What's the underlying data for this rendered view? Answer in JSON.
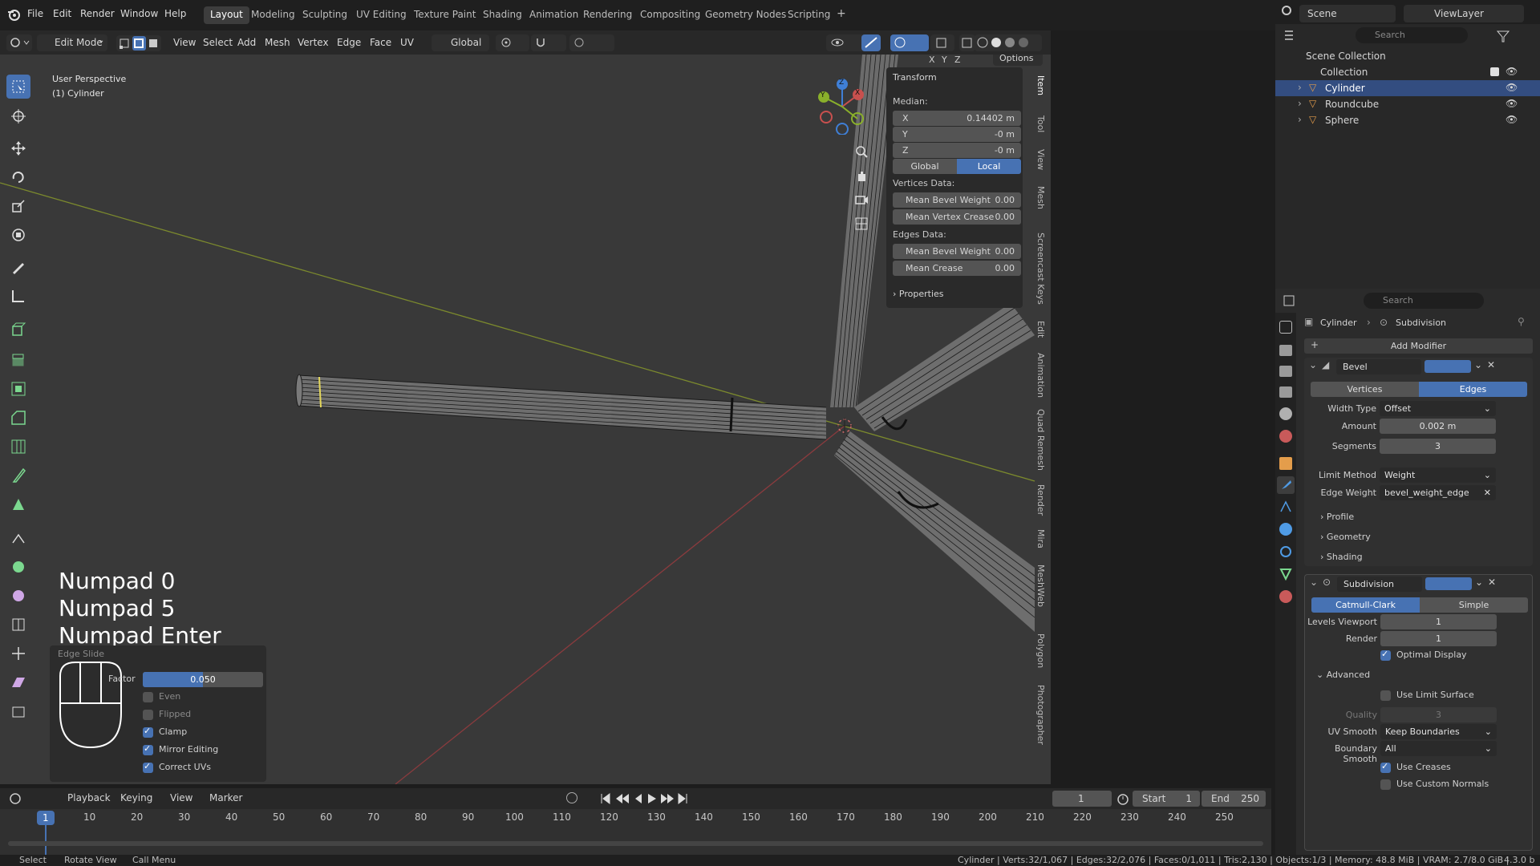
{
  "topbar": {
    "menus": [
      "File",
      "Edit",
      "Render",
      "Window",
      "Help"
    ],
    "workspaces": [
      "Layout",
      "Modeling",
      "Sculpting",
      "UV Editing",
      "Texture Paint",
      "Shading",
      "Animation",
      "Rendering",
      "Compositing",
      "Geometry Nodes",
      "Scripting"
    ],
    "active_workspace": "Layout",
    "add_tab": "+",
    "scene_label": "Scene",
    "viewlayer_label": "ViewLayer"
  },
  "viewport_header": {
    "mode": "Edit Mode",
    "menus": [
      "View",
      "Select",
      "Add",
      "Mesh",
      "Vertex",
      "Edge",
      "Face",
      "UV"
    ],
    "orientation": "Global",
    "options_label": "Options",
    "axes": [
      "X",
      "Y",
      "Z"
    ]
  },
  "viewport": {
    "perspective_label": "User Perspective",
    "object_label": "(1) Cylinder",
    "keystrokes": [
      "Numpad 0",
      "Numpad 5",
      "Numpad Enter"
    ],
    "gizmo_axes": [
      "X",
      "Y",
      "Z"
    ]
  },
  "npanel": {
    "section_transform": "Transform",
    "median_label": "Median:",
    "x_label": "X",
    "x_value": "0.14402 m",
    "y_label": "Y",
    "y_value": "-0 m",
    "z_label": "Z",
    "z_value": "-0 m",
    "global_btn": "Global",
    "local_btn": "Local",
    "vertices_data_label": "Vertices Data:",
    "mean_bevel_weight_label": "Mean Bevel Weight",
    "mean_bevel_weight_value": "0.00",
    "mean_vertex_crease_label": "Mean Vertex Crease",
    "mean_vertex_crease_value": "0.00",
    "edges_data_label": "Edges Data:",
    "edge_mean_bevel_weight_label": "Mean Bevel Weight",
    "edge_mean_bevel_weight_value": "0.00",
    "mean_crease_label": "Mean Crease",
    "mean_crease_value": "0.00",
    "properties_label": "Properties",
    "tabs": [
      "Item",
      "Tool",
      "View",
      "Mesh",
      "Screencast Keys",
      "Edit",
      "Animation",
      "Quad Remesh",
      "Render",
      "Mira",
      "MeshWeb",
      "Polygon",
      "Photographer"
    ]
  },
  "edge_slide": {
    "title": "Edge Slide",
    "factor_label": "Factor",
    "factor_value": "0.050",
    "factor_fill_fraction": 0.5,
    "even_label": "Even",
    "even_checked": false,
    "flipped_label": "Flipped",
    "flipped_checked": false,
    "clamp_label": "Clamp",
    "clamp_checked": true,
    "mirror_label": "Mirror Editing",
    "mirror_checked": true,
    "correct_uvs_label": "Correct UVs",
    "correct_uvs_checked": true
  },
  "timeline": {
    "menus": [
      "Playback",
      "Keying",
      "View",
      "Marker"
    ],
    "current_frame": "1",
    "start_label": "Start",
    "start_value": "1",
    "end_label": "End",
    "end_value": "250",
    "ticks": [
      "10",
      "20",
      "30",
      "40",
      "50",
      "60",
      "70",
      "80",
      "90",
      "100",
      "110",
      "120",
      "130",
      "140",
      "150",
      "160",
      "170",
      "180",
      "190",
      "200",
      "210",
      "220",
      "230",
      "240",
      "250"
    ],
    "playhead_label": "1"
  },
  "statusbar": {
    "select": "Select",
    "rotate_view": "Rotate View",
    "call_menu": "Call Menu",
    "stats": "Cylinder | Verts:32/1,067 | Edges:32/2,076 | Faces:0/1,011 | Tris:2,130 | Objects:1/3 | Memory: 48.8 MiB | VRAM: 2.7/8.0 GiB |",
    "version": "4.3.0 b"
  },
  "outliner": {
    "search_placeholder": "Search",
    "scene_collection": "Scene Collection",
    "collection": "Collection",
    "objects": [
      "Cylinder",
      "Roundcube",
      "Sphere"
    ],
    "selected": "Cylinder"
  },
  "properties": {
    "search_placeholder": "Search",
    "breadcrumb_object": "Cylinder",
    "breadcrumb_modifier": "Subdivision",
    "add_modifier": "Add Modifier",
    "bevel": {
      "name": "Bevel",
      "vertices_btn": "Vertices",
      "edges_btn": "Edges",
      "width_type_label": "Width Type",
      "width_type_value": "Offset",
      "amount_label": "Amount",
      "amount_value": "0.002 m",
      "segments_label": "Segments",
      "segments_value": "3",
      "limit_method_label": "Limit Method",
      "limit_method_value": "Weight",
      "edge_weight_label": "Edge Weight",
      "edge_weight_value": "bevel_weight_edge",
      "profile_label": "Profile",
      "geometry_label": "Geometry",
      "shading_label": "Shading"
    },
    "subdivision": {
      "name": "Subdivision",
      "catmull_btn": "Catmull-Clark",
      "simple_btn": "Simple",
      "levels_viewport_label": "Levels Viewport",
      "levels_viewport_value": "1",
      "render_label": "Render",
      "render_value": "1",
      "optimal_display_label": "Optimal Display",
      "advanced_label": "Advanced",
      "use_limit_surface_label": "Use Limit Surface",
      "quality_label": "Quality",
      "quality_value": "3",
      "uv_smooth_label": "UV Smooth",
      "uv_smooth_value": "Keep Boundaries",
      "boundary_smooth_label": "Boundary Smooth",
      "boundary_smooth_value": "All",
      "use_creases_label": "Use Creases",
      "use_custom_normals_label": "Use Custom Normals"
    }
  },
  "colors": {
    "accent": "#4772b3",
    "selected_row": "#334d80",
    "viewport_bg": "#393939",
    "x_axis": "#c8504e",
    "y_axis": "#8ab02b",
    "z_axis": "#3f7fd6"
  }
}
